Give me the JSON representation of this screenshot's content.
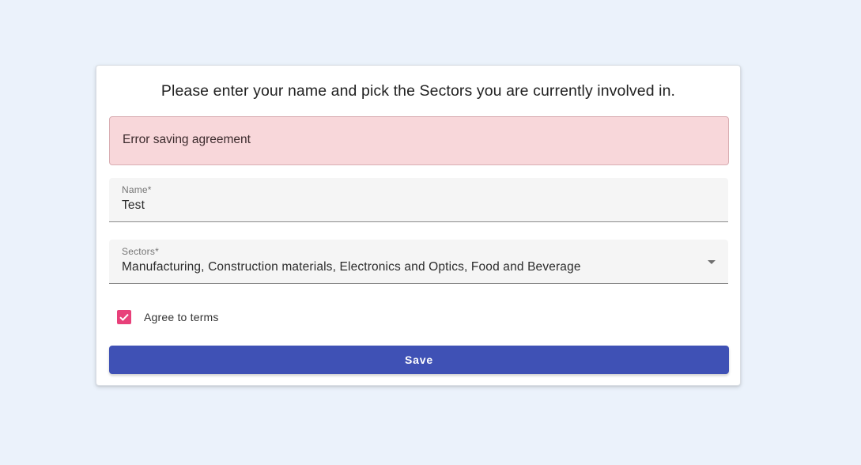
{
  "form": {
    "title": "Please enter your name and pick the Sectors you are currently involved in.",
    "error_message": "Error saving agreement",
    "name_field": {
      "label": "Name*",
      "value": "Test"
    },
    "sectors_field": {
      "label": "Sectors*",
      "selected_value": "Manufacturing, Construction materials, Electronics and Optics, Food and Beverage"
    },
    "agree_checkbox": {
      "label": "Agree to terms",
      "checked": true
    },
    "save_label": "Save"
  },
  "colors": {
    "page_background": "#ebf2fb",
    "error_background": "#f8d7da",
    "checkbox_accent": "#e8407a",
    "primary_button": "#3f51b5"
  },
  "icons": {
    "checkbox": "check-icon",
    "dropdown": "chevron-down-icon"
  }
}
